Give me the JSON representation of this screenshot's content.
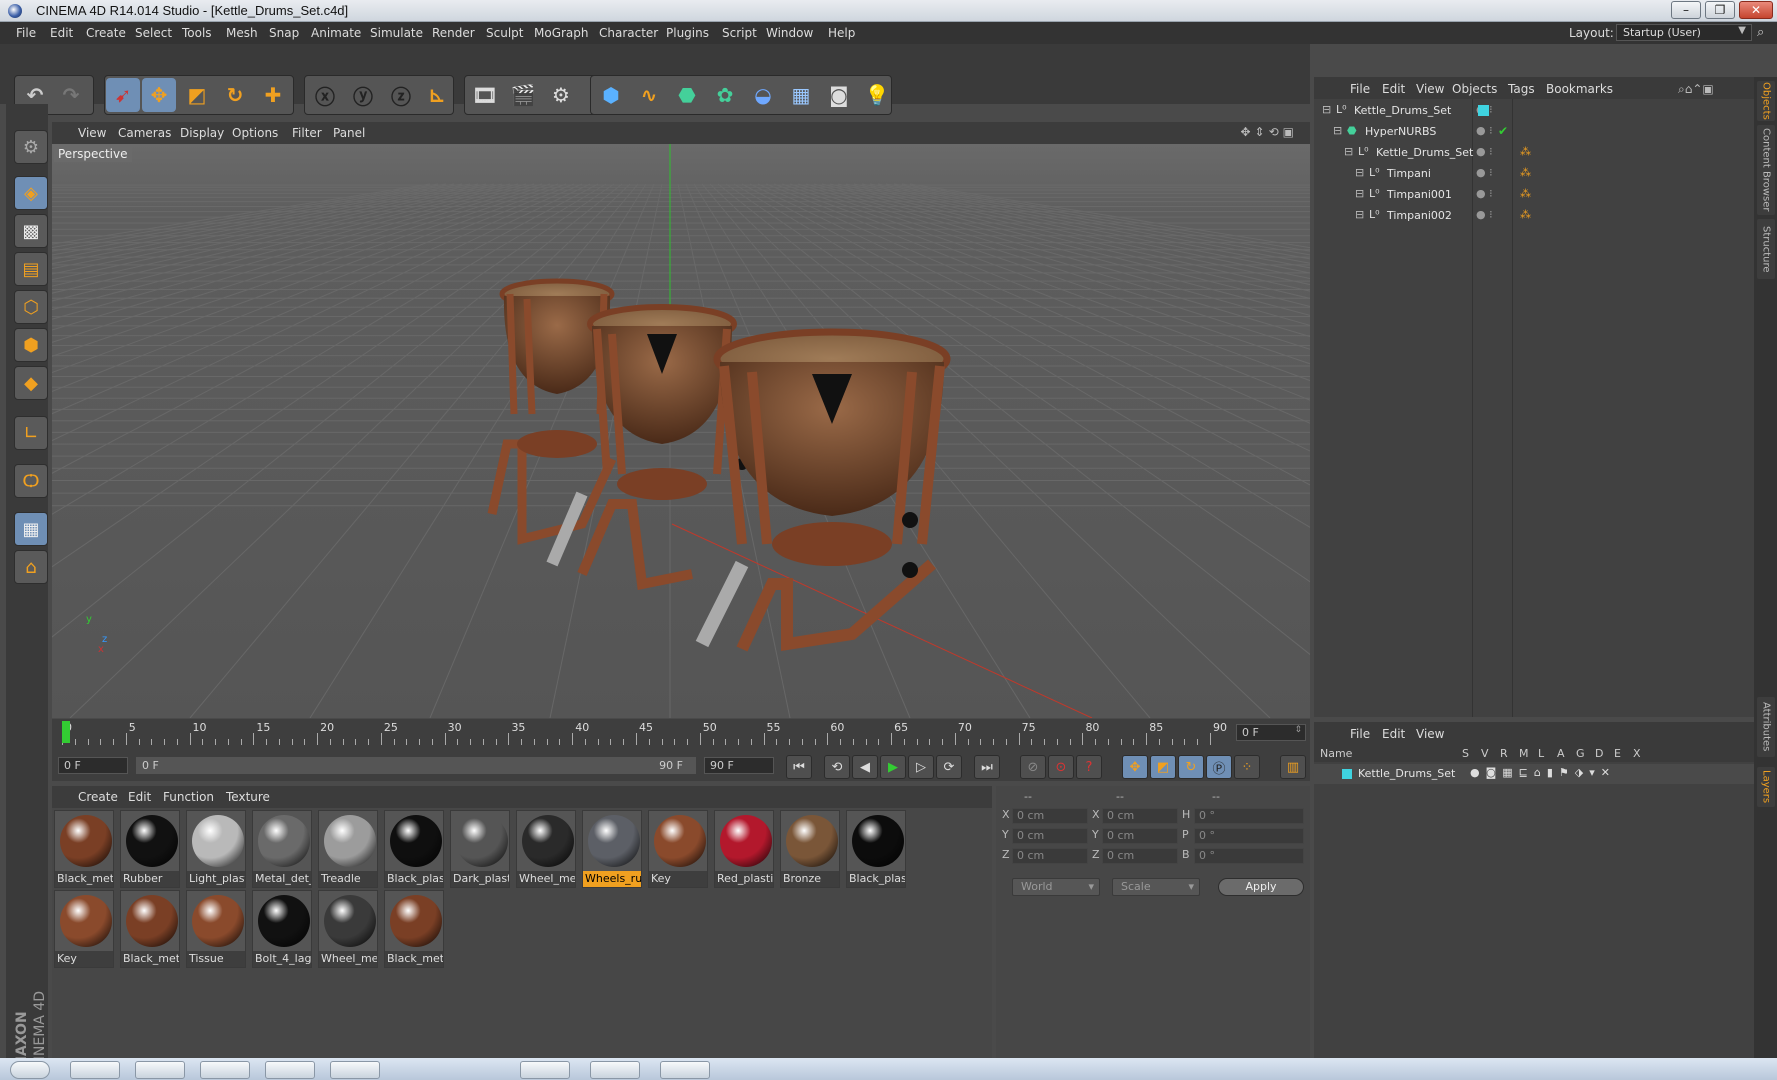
{
  "window": {
    "title": "CINEMA 4D R14.014 Studio - [Kettle_Drums_Set.c4d]",
    "minimize": "–",
    "restore": "❐",
    "close": "✕"
  },
  "menubar": {
    "items": [
      "File",
      "Edit",
      "Create",
      "Select",
      "Tools",
      "Mesh",
      "Snap",
      "Animate",
      "Simulate",
      "Render",
      "Sculpt",
      "MoGraph",
      "Character",
      "Plugins",
      "Script",
      "Window",
      "Help"
    ],
    "layout_label": "Layout:",
    "layout_value": "Startup (User)"
  },
  "viewport": {
    "menu": [
      "View",
      "Cameras",
      "Display",
      "Options",
      "Filter",
      "Panel"
    ],
    "label": "Perspective",
    "axis_x": "x",
    "axis_y": "y",
    "axis_z": "z"
  },
  "timeline": {
    "ticks": [
      "0",
      "5",
      "10",
      "15",
      "20",
      "25",
      "30",
      "35",
      "40",
      "45",
      "50",
      "55",
      "60",
      "65",
      "70",
      "75",
      "80",
      "85",
      "90"
    ],
    "current_frame": "0 F"
  },
  "playback": {
    "start": "0 F",
    "range_start": "0 F",
    "range_end": "90 F",
    "end": "90 F"
  },
  "materials": {
    "menu": [
      "Create",
      "Edit",
      "Function",
      "Texture"
    ],
    "items": [
      {
        "label": "Black_meta",
        "color": "#7a3f25"
      },
      {
        "label": "Rubber",
        "color": "#111111"
      },
      {
        "label": "Light_plast",
        "color": "#b9b9b9"
      },
      {
        "label": "Metal_det_",
        "color": "#6a6a6a"
      },
      {
        "label": "Treadle",
        "color": "#9c9c9c"
      },
      {
        "label": "Black_plast",
        "color": "#0f0f0f"
      },
      {
        "label": "Dark_plasti",
        "color": "#555555"
      },
      {
        "label": "Wheel_met",
        "color": "#2a2a2a"
      },
      {
        "label": "Wheels_rul",
        "color": "#5c5f66"
      },
      {
        "label": "Key",
        "color": "#8a4a2c"
      },
      {
        "label": "Red_plastic",
        "color": "#b3182c"
      },
      {
        "label": "Bronze",
        "color": "#7a5638"
      },
      {
        "label": "Black_plast",
        "color": "#0c0c0c"
      },
      {
        "label": "Key",
        "color": "#8a4a2c"
      },
      {
        "label": "Black_meta",
        "color": "#7a3f25"
      },
      {
        "label": "Tissue",
        "color": "#8a4a2c"
      },
      {
        "label": "Bolt_4_lag",
        "color": "#111111"
      },
      {
        "label": "Wheel_met",
        "color": "#3a3a3a"
      },
      {
        "label": "Black_meta",
        "color": "#7a3f25"
      }
    ],
    "selected_index": 8
  },
  "coords": {
    "headers": [
      "--",
      "--",
      "--"
    ],
    "rows": [
      {
        "a": "X",
        "av": "0 cm",
        "b": "X",
        "bv": "0 cm",
        "c": "H",
        "cv": "0 °"
      },
      {
        "a": "Y",
        "av": "0 cm",
        "b": "Y",
        "bv": "0 cm",
        "c": "P",
        "cv": "0 °"
      },
      {
        "a": "Z",
        "av": "0 cm",
        "b": "Z",
        "bv": "0 cm",
        "c": "B",
        "cv": "0 °"
      }
    ],
    "world": "World",
    "scale": "Scale",
    "apply": "Apply"
  },
  "objects": {
    "menu": [
      "File",
      "Edit",
      "View",
      "Objects",
      "Tags",
      "Bookmarks"
    ],
    "tree": [
      {
        "label": "Kettle_Drums_Set",
        "depth": 0
      },
      {
        "label": "HyperNURBS",
        "depth": 1
      },
      {
        "label": "Kettle_Drums_Set",
        "depth": 2
      },
      {
        "label": "Timpani",
        "depth": 3
      },
      {
        "label": "Timpani001",
        "depth": 3
      },
      {
        "label": "Timpani002",
        "depth": 3
      }
    ]
  },
  "layers": {
    "menu": [
      "File",
      "Edit",
      "View"
    ],
    "col_name": "Name",
    "cols": [
      "S",
      "V",
      "R",
      "M",
      "L",
      "A",
      "G",
      "D",
      "E",
      "X"
    ],
    "row": "Kettle_Drums_Set"
  },
  "sidetabs": [
    "Objects",
    "Content Browser",
    "Structure",
    "Attributes",
    "Layers"
  ],
  "colors": {
    "accent": "#f0a020",
    "selection": "#6f8fb5",
    "background": "#4a4a4a"
  }
}
